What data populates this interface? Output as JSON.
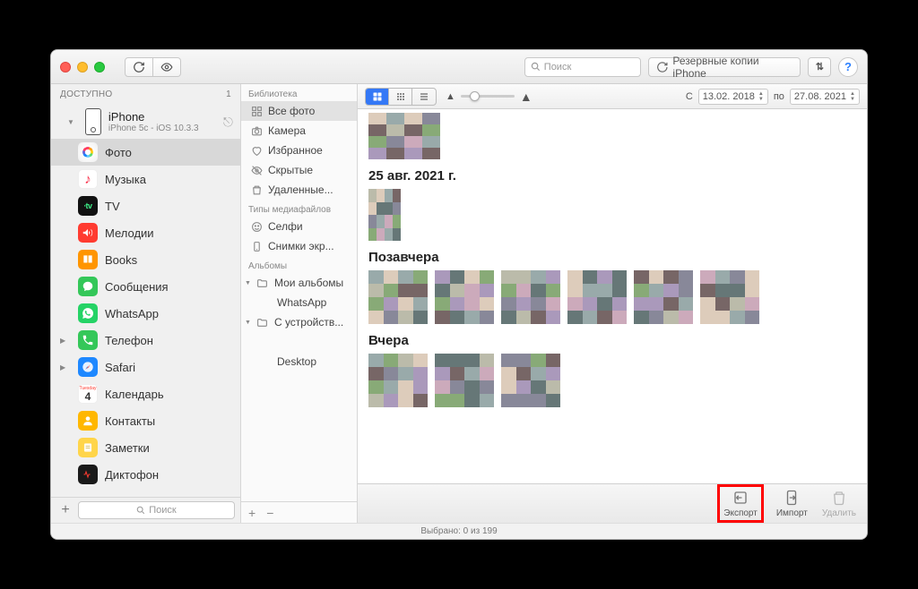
{
  "titlebar": {
    "search_placeholder": "Поиск",
    "backups_label": "Резервные копии iPhone"
  },
  "left": {
    "header": "ДОСТУПНО",
    "header_count": "1",
    "device_name": "iPhone",
    "device_sub": "iPhone 5c - iOS 10.3.3",
    "items": [
      {
        "label": "Фото",
        "kind": "photos",
        "selected": true
      },
      {
        "label": "Музыка",
        "kind": "music"
      },
      {
        "label": "TV",
        "kind": "tv"
      },
      {
        "label": "Мелодии",
        "kind": "ring"
      },
      {
        "label": "Books",
        "kind": "books"
      },
      {
        "label": "Сообщения",
        "kind": "msg"
      },
      {
        "label": "WhatsApp",
        "kind": "wa"
      },
      {
        "label": "Телефон",
        "kind": "phone",
        "expandable": true
      },
      {
        "label": "Safari",
        "kind": "safari",
        "expandable": true
      },
      {
        "label": "Календарь",
        "kind": "cal"
      },
      {
        "label": "Контакты",
        "kind": "contacts"
      },
      {
        "label": "Заметки",
        "kind": "notes"
      },
      {
        "label": "Диктофон",
        "kind": "voice"
      }
    ],
    "footer_search_placeholder": "Поиск"
  },
  "mid": {
    "groups": [
      {
        "title": "Библиотека",
        "items": [
          {
            "label": "Все фото",
            "icon": "grid",
            "selected": true
          },
          {
            "label": "Камера",
            "icon": "camera"
          },
          {
            "label": "Избранное",
            "icon": "heart"
          },
          {
            "label": "Скрытые",
            "icon": "eyeoff"
          },
          {
            "label": "Удаленные...",
            "icon": "trash"
          }
        ]
      },
      {
        "title": "Типы медиафайлов",
        "items": [
          {
            "label": "Селфи",
            "icon": "face"
          },
          {
            "label": "Снимки экр...",
            "icon": "device"
          }
        ]
      },
      {
        "title": "Альбомы",
        "items": [
          {
            "label": "Мои альбомы",
            "icon": "folder",
            "collapsible": true
          },
          {
            "label": "WhatsApp",
            "icon": "folder",
            "indent": true
          },
          {
            "label": "С устройств...",
            "icon": "folder",
            "collapsible": true
          },
          {
            "label": "",
            "icon": "camera2",
            "indent": true
          },
          {
            "label": "Desktop",
            "icon": "folder",
            "indent": true
          }
        ]
      }
    ]
  },
  "right": {
    "date_from_label": "С",
    "date_from": "13.02. 2018",
    "date_to_label": "по",
    "date_to": "27.08. 2021",
    "sections": [
      {
        "title": "",
        "count": 1
      },
      {
        "title": "25 авг. 2021 г.",
        "count": 1
      },
      {
        "title": "Позавчера",
        "count": 6
      },
      {
        "title": "Вчера",
        "count": 3
      }
    ]
  },
  "bottom": {
    "export": "Экспорт",
    "import": "Импорт",
    "delete": "Удалить"
  },
  "status": "Выбрано: 0 из 199"
}
